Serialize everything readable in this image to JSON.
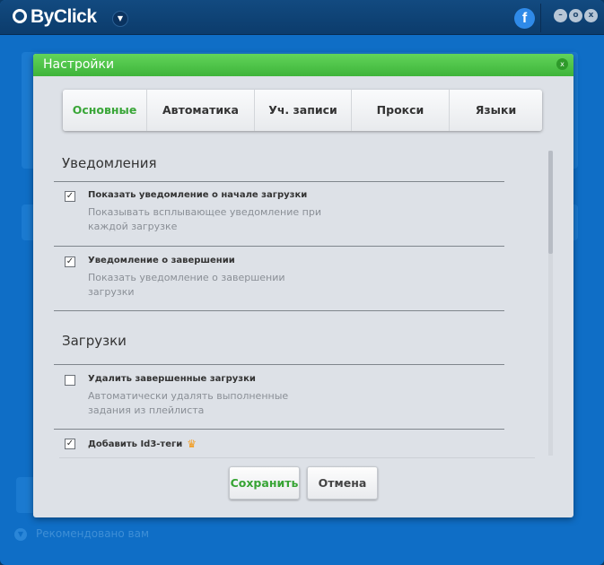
{
  "app": {
    "title": "ByClick",
    "recommended": "Рекомендовано вам"
  },
  "dialog": {
    "title": "Настройки",
    "close": "x",
    "tabs": [
      {
        "label": "Основные"
      },
      {
        "label": "Автоматика"
      },
      {
        "label": "Уч. записи"
      },
      {
        "label": "Прокси"
      },
      {
        "label": "Языки"
      }
    ],
    "sections": [
      {
        "title": "Уведомления",
        "items": [
          {
            "label": "Показать уведомление о начале загрузки",
            "desc": "Показывать всплывающее уведомление при каждой загрузке",
            "checked": true
          },
          {
            "label": "Уведомление о завершении",
            "desc": "Показать уведомление о завершении загрузки",
            "checked": true
          }
        ]
      },
      {
        "title": "Загрузки",
        "items": [
          {
            "label": "Удалить завершенные загрузки",
            "desc": "Автоматически удалять выполненные задания из плейлиста",
            "checked": false
          },
          {
            "label": "Добавить Id3-теги",
            "desc": "",
            "checked": true,
            "premium": true
          }
        ]
      }
    ],
    "save": "Сохранить",
    "cancel": "Отмена"
  },
  "colors": {
    "accent": "#3aa638",
    "header": "#4cc447",
    "app_bg": "#0f6ec6"
  }
}
